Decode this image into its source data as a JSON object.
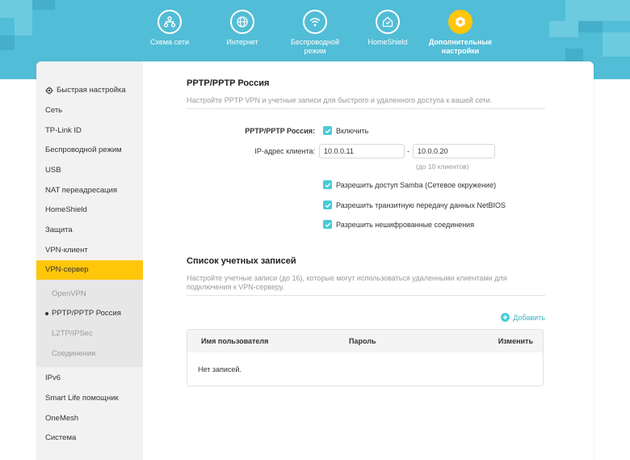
{
  "nav": {
    "items": [
      {
        "label": "Схема сети",
        "icon": "network-map-icon"
      },
      {
        "label": "Интернет",
        "icon": "globe-icon"
      },
      {
        "label": "Беспроводной режим",
        "icon": "wifi-icon"
      },
      {
        "label": "HomeShield",
        "icon": "home-shield-icon"
      },
      {
        "label": "Дополнительные настройки",
        "icon": "gear-icon",
        "active": true
      }
    ]
  },
  "sidebar": {
    "quick_setup": "Быстрая настройка",
    "items": [
      "Сеть",
      "TP-Link ID",
      "Беспроводной режим",
      "USB",
      "NAT переадресация",
      "HomeShield",
      "Защита",
      "VPN-клиент"
    ],
    "active": "VPN-сервер",
    "sub_items": [
      "OpenVPN",
      "PPTP/PPTP Россия",
      "L2TP/IPSec",
      "Соединения"
    ],
    "sub_current_index": 1,
    "after_items": [
      "IPv6",
      "Smart Life помощник",
      "OneMesh",
      "Система"
    ]
  },
  "pptp": {
    "title": "PPTP/PPTP Россия",
    "description": "Настройте PPTP VPN и учетные записи для быстрого и удаленного доступа к вашей сети.",
    "enable_label": "PPTP/PPTP Россия:",
    "enable_checkbox": "Включить",
    "enable_checked": true,
    "ip_label": "IP-адрес клиента:",
    "ip_start": "10.0.0.11",
    "ip_separator": "-",
    "ip_end": "10.0.0.20",
    "ip_hint": "(до 10 клиентов)",
    "options": [
      {
        "label": "Разрешить доступ Samba (Сетевое окружение)",
        "checked": true
      },
      {
        "label": "Разрешить транзитную передачу данных NetBIOS",
        "checked": true
      },
      {
        "label": "Разрешить нешифрованные соединения",
        "checked": true
      }
    ]
  },
  "accounts": {
    "title": "Список учетных записей",
    "description": "Настройте учетные записи (до 16), которые могут использоваться удаленными клиентами для подключения к VPN-серверу.",
    "add_label": "Добавить",
    "columns": [
      "Имя пользователя",
      "Пароль",
      "Изменить"
    ],
    "empty_text": "Нет записей."
  },
  "colors": {
    "header": "#52bdd6",
    "accent_yellow": "#ffc60a",
    "accent_teal": "#4acbd6"
  }
}
